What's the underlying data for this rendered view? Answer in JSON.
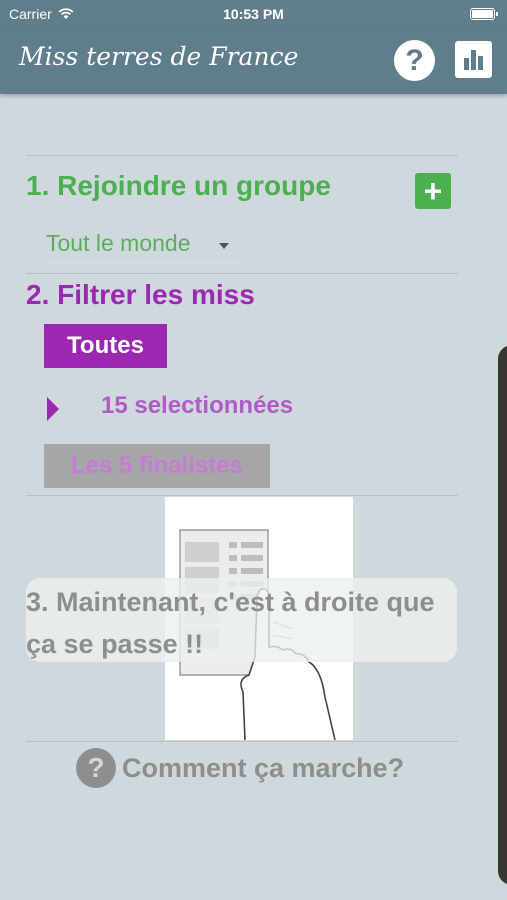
{
  "status_bar": {
    "carrier": "Carrier",
    "time": "10:53 PM"
  },
  "nav": {
    "title": "Miss terres de France",
    "help_icon": "question-circle-icon",
    "stats_icon": "bar-chart-icon"
  },
  "section1": {
    "title": "1. Rejoindre un groupe",
    "add_label": "+",
    "group_value": "Tout le monde"
  },
  "section2": {
    "title": "2. Filtrer les miss",
    "all_label": "Toutes",
    "selected_label": "15 selectionnées",
    "finalists_label": "Les 5 finalistes"
  },
  "section3": {
    "hint": "3. Maintenant, c'est à droite que ça se passe !!"
  },
  "howto": {
    "icon_label": "?",
    "label": "Comment ça marche?"
  },
  "colors": {
    "nav": "#607d8b",
    "green": "#4caf50",
    "purple": "#9c27b0",
    "gray": "#8e8e8e",
    "background": "#cfd8dc"
  }
}
